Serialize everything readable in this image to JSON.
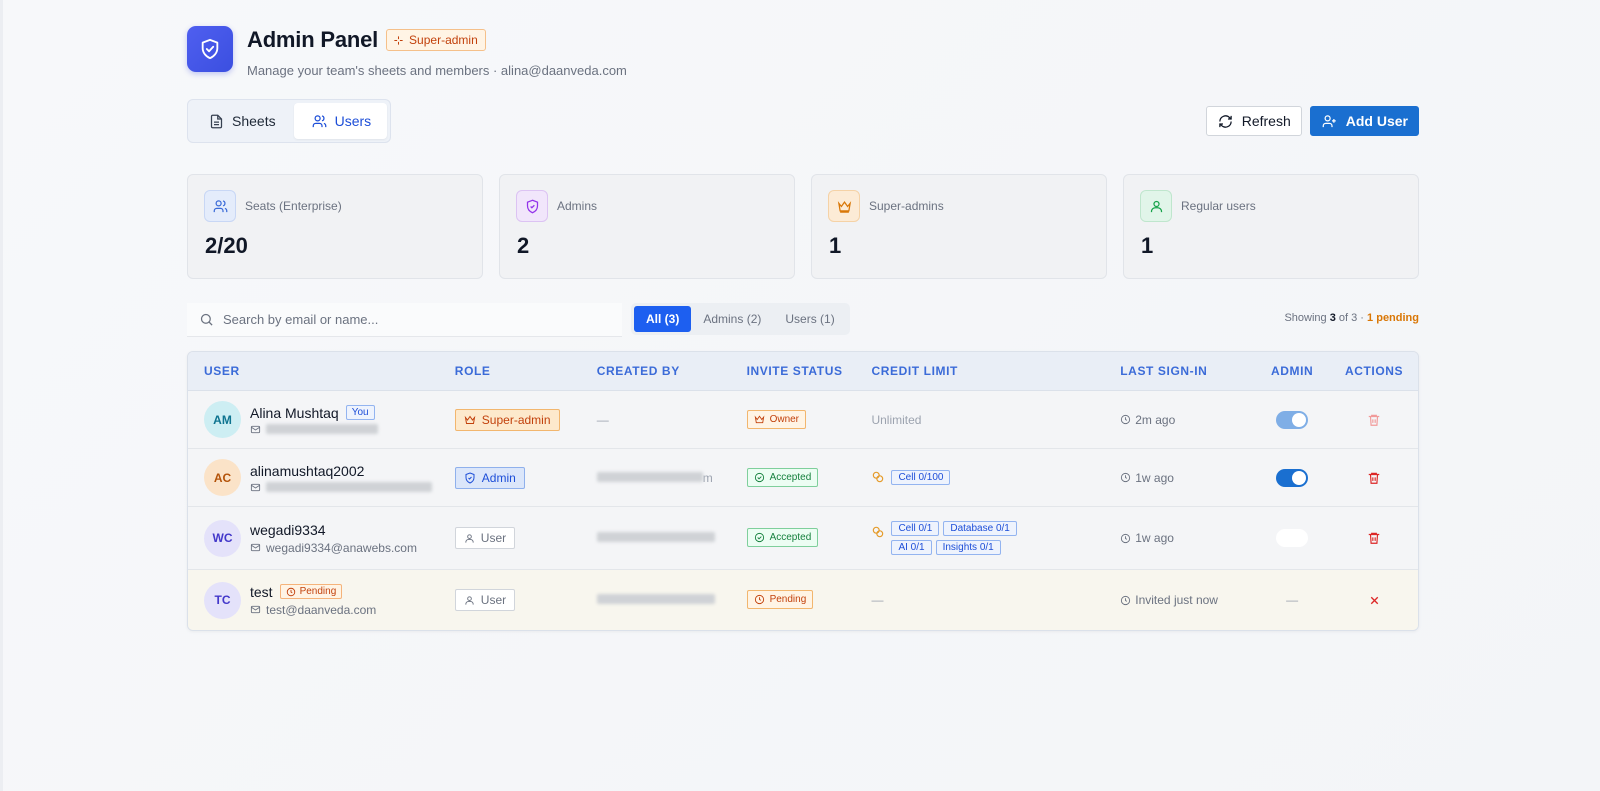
{
  "header": {
    "title": "Admin Panel",
    "role_badge": "Super-admin",
    "subtitle": "Manage your team's sheets and members · alina@daanveda.com"
  },
  "tabs": [
    {
      "label": "Sheets",
      "icon": "file-icon",
      "active": false
    },
    {
      "label": "Users",
      "icon": "users-icon",
      "active": true
    }
  ],
  "toolbar": {
    "refresh_label": "Refresh",
    "add_user_label": "Add User"
  },
  "stats": [
    {
      "label": "Seats (Enterprise)",
      "value": "2/20",
      "icon": "users-icon",
      "color": "#3b6bd8"
    },
    {
      "label": "Admins",
      "value": "2",
      "icon": "shield-icon",
      "color": "#9333ea"
    },
    {
      "label": "Super-admins",
      "value": "1",
      "icon": "crown-icon",
      "color": "#d97706"
    },
    {
      "label": "Regular users",
      "value": "1",
      "icon": "user-icon",
      "color": "#16a34a"
    }
  ],
  "search": {
    "placeholder": "Search by email or name..."
  },
  "filters": [
    {
      "label": "All (3)",
      "active": true
    },
    {
      "label": "Admins (2)",
      "active": false
    },
    {
      "label": "Users (1)",
      "active": false
    }
  ],
  "showing": {
    "prefix": "Showing",
    "count": "3",
    "of": "of 3 ·",
    "pending": "1 pending"
  },
  "table": {
    "columns": [
      "User",
      "Role",
      "Created by",
      "Invite status",
      "Credit limit",
      "Last sign-in",
      "Admin",
      "Actions"
    ],
    "rows": [
      {
        "initials": "AM",
        "name": "Alina Mushtaq",
        "tag": "You",
        "email": "",
        "role": "Super-admin",
        "created_by": "—",
        "invite": "Owner",
        "credit_text": "Unlimited",
        "chips": [],
        "last_sign_in": "2m ago",
        "admin": "on-dim",
        "action": "delete"
      },
      {
        "initials": "AC",
        "name": "alinamushtaq2002",
        "tag": "",
        "email": "",
        "role": "Admin",
        "created_by": "m",
        "invite": "Accepted",
        "credit_text": "",
        "chips": [
          "Cell 0/100"
        ],
        "last_sign_in": "1w ago",
        "admin": "on",
        "action": "delete"
      },
      {
        "initials": "WC",
        "name": "wegadi9334",
        "tag": "",
        "email": "wegadi9334@anawebs.com",
        "role": "User",
        "created_by": "",
        "invite": "Accepted",
        "credit_text": "",
        "chips": [
          "Cell 0/1",
          "Database 0/1",
          "AI 0/1",
          "Insights 0/1"
        ],
        "last_sign_in": "1w ago",
        "admin": "off",
        "action": "delete"
      },
      {
        "initials": "TC",
        "name": "test",
        "tag": "Pending",
        "email": "test@daanveda.com",
        "role": "User",
        "created_by": "",
        "invite": "Pending",
        "credit_text": "—",
        "chips": [],
        "last_sign_in": "Invited just now",
        "admin": "—",
        "action": "cancel"
      }
    ]
  }
}
